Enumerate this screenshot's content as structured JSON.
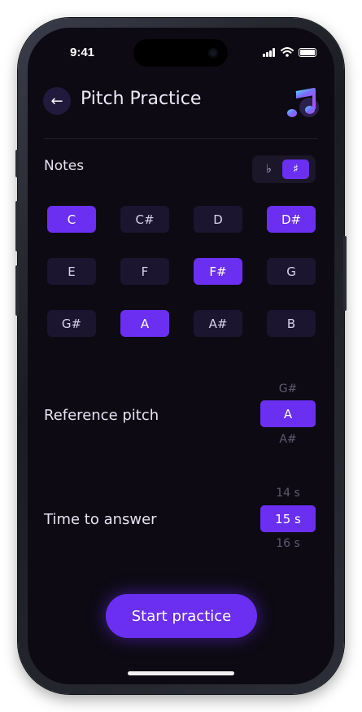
{
  "status_bar": {
    "time": "9:41"
  },
  "header": {
    "title": "Pitch Practice",
    "back_glyph": "←"
  },
  "notes": {
    "label": "Notes",
    "accidentals": [
      {
        "glyph": "♭",
        "selected": false
      },
      {
        "glyph": "♯",
        "selected": true
      }
    ],
    "items": [
      {
        "name": "C",
        "selected": true
      },
      {
        "name": "C#",
        "selected": false
      },
      {
        "name": "D",
        "selected": false
      },
      {
        "name": "D#",
        "selected": true
      },
      {
        "name": "E",
        "selected": false
      },
      {
        "name": "F",
        "selected": false
      },
      {
        "name": "F#",
        "selected": true
      },
      {
        "name": "G",
        "selected": false
      },
      {
        "name": "G#",
        "selected": false
      },
      {
        "name": "A",
        "selected": true
      },
      {
        "name": "A#",
        "selected": false
      },
      {
        "name": "B",
        "selected": false
      }
    ]
  },
  "reference_pitch": {
    "label": "Reference pitch",
    "prev": "G#",
    "selected": "A",
    "next": "A#"
  },
  "time_to_answer": {
    "label": "Time to answer",
    "prev": "14 s",
    "selected": "15 s",
    "next": "16 s"
  },
  "start_button": {
    "label": "Start practice"
  },
  "colors": {
    "accent": "#6a2ff0",
    "background": "#0d0a13",
    "chip": "#1b1530"
  }
}
